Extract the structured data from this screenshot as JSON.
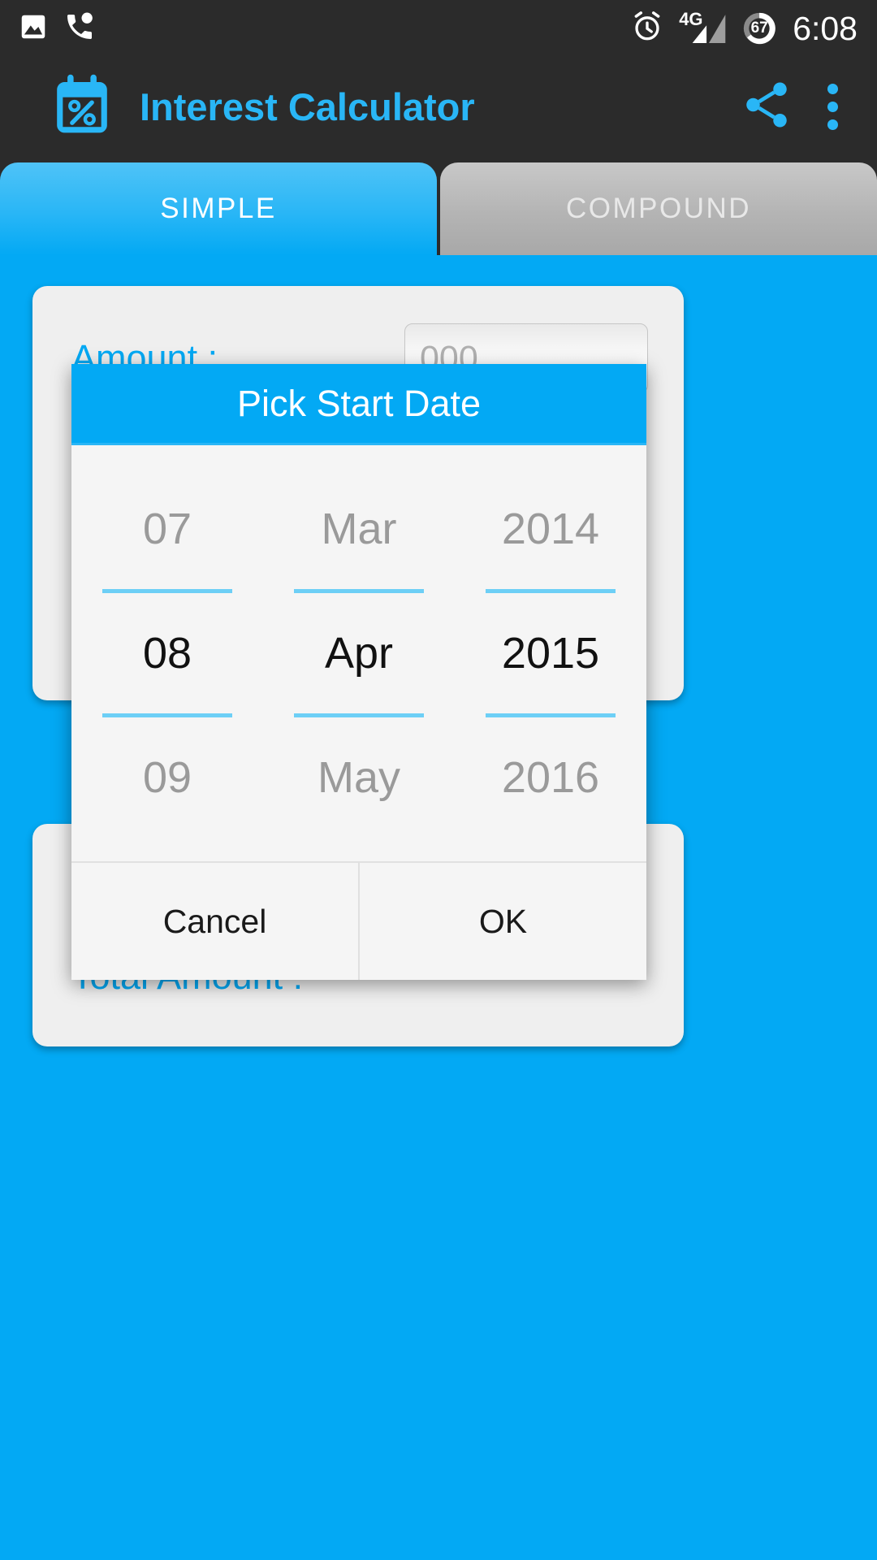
{
  "status_bar": {
    "time": "6:08",
    "battery_level": "67",
    "network_type": "4G",
    "icons": [
      "image-icon",
      "missed-call-icon",
      "alarm-icon",
      "signal-icon",
      "battery-icon"
    ]
  },
  "app_bar": {
    "title": "Interest Calculator",
    "icon": "calendar-percent-icon",
    "share_icon": "share-icon",
    "overflow_icon": "overflow-menu-icon",
    "accent_color": "#29B6F6",
    "background_color": "#2B2B2B"
  },
  "tabs": [
    {
      "label": "SIMPLE",
      "selected": true
    },
    {
      "label": "COMPOUND",
      "selected": false
    }
  ],
  "simple_card": {
    "amount": {
      "label": "Amount :",
      "value": "",
      "placeholder": "000"
    }
  },
  "total_card": {
    "total_amount_label": "Total Amount :"
  },
  "dialog": {
    "title": "Pick Start Date",
    "title_bar_color": "#03A9F4",
    "picker": {
      "day": {
        "above": "07",
        "selected": "08",
        "below": "09"
      },
      "month": {
        "above": "Mar",
        "selected": "Apr",
        "below": "May"
      },
      "year": {
        "above": "2014",
        "selected": "2015",
        "below": "2016"
      }
    },
    "buttons": {
      "cancel": "Cancel",
      "ok": "OK"
    }
  },
  "theme": {
    "background": "#03A9F4",
    "card_background": "#EFEFEF",
    "divider_blue": "#6DCFF6"
  }
}
